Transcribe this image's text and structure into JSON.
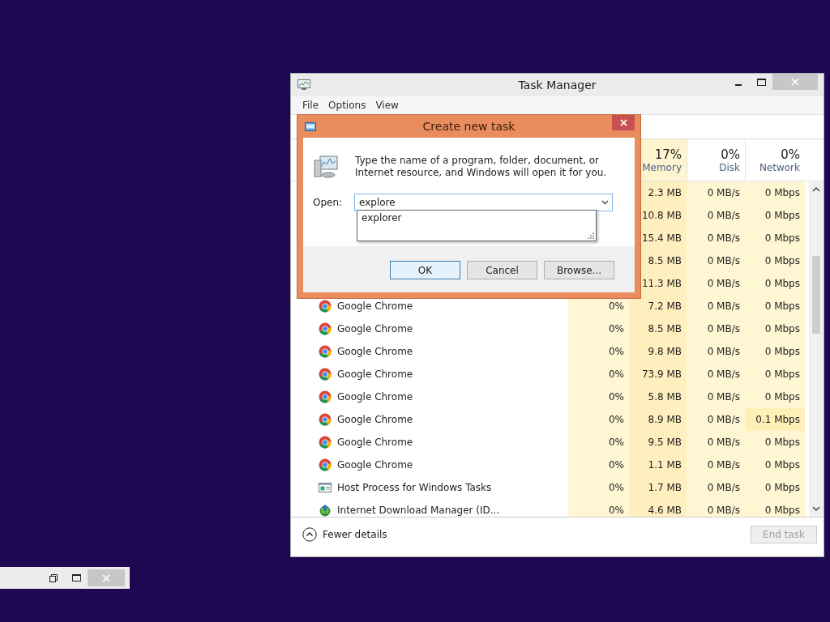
{
  "task_manager": {
    "title": "Task Manager",
    "menu": [
      "File",
      "Options",
      "View"
    ],
    "columns": [
      {
        "percent": "17%",
        "label": "Memory"
      },
      {
        "percent": "0%",
        "label": "Disk"
      },
      {
        "percent": "0%",
        "label": "Network"
      }
    ],
    "rows": [
      {
        "memory": "2.3 MB",
        "disk": "0 MB/s",
        "network": "0 Mbps"
      },
      {
        "memory": "10.8 MB",
        "disk": "0 MB/s",
        "network": "0 Mbps"
      },
      {
        "memory": "15.4 MB",
        "disk": "0 MB/s",
        "network": "0 Mbps"
      },
      {
        "memory": "8.5 MB",
        "disk": "0 MB/s",
        "network": "0 Mbps"
      },
      {
        "memory": "11.3 MB",
        "disk": "0 MB/s",
        "network": "0 Mbps"
      },
      {
        "kind": "chrome",
        "name": "Google Chrome",
        "cpu": "0%",
        "memory": "7.2 MB",
        "disk": "0 MB/s",
        "network": "0 Mbps"
      },
      {
        "kind": "chrome",
        "name": "Google Chrome",
        "cpu": "0%",
        "memory": "8.5 MB",
        "disk": "0 MB/s",
        "network": "0 Mbps"
      },
      {
        "kind": "chrome",
        "name": "Google Chrome",
        "cpu": "0%",
        "memory": "9.8 MB",
        "disk": "0 MB/s",
        "network": "0 Mbps"
      },
      {
        "kind": "chrome",
        "name": "Google Chrome",
        "cpu": "0%",
        "memory": "73.9 MB",
        "disk": "0 MB/s",
        "network": "0 Mbps"
      },
      {
        "kind": "chrome",
        "name": "Google Chrome",
        "cpu": "0%",
        "memory": "5.8 MB",
        "disk": "0 MB/s",
        "network": "0 Mbps"
      },
      {
        "kind": "chrome",
        "name": "Google Chrome",
        "cpu": "0%",
        "memory": "8.9 MB",
        "disk": "0 MB/s",
        "network": "0.1 Mbps"
      },
      {
        "kind": "chrome",
        "name": "Google Chrome",
        "cpu": "0%",
        "memory": "9.5 MB",
        "disk": "0 MB/s",
        "network": "0 Mbps"
      },
      {
        "kind": "chrome",
        "name": "Google Chrome",
        "cpu": "0%",
        "memory": "1.1 MB",
        "disk": "0 MB/s",
        "network": "0 Mbps"
      },
      {
        "kind": "host",
        "name": "Host Process for Windows Tasks",
        "cpu": "0%",
        "memory": "1.7 MB",
        "disk": "0 MB/s",
        "network": "0 Mbps"
      },
      {
        "kind": "idm",
        "name": "Internet Download Manager (ID...",
        "cpu": "0%",
        "memory": "4.6 MB",
        "disk": "0 MB/s",
        "network": "0 Mbps"
      }
    ],
    "fewer_details": "Fewer details",
    "end_task": {
      "label": "End task",
      "disabled": true
    }
  },
  "dialog": {
    "title": "Create new task",
    "message": "Type the name of a program, folder, document, or Internet resource, and Windows will open it for you.",
    "open_label": "Open:",
    "open_value": "explore",
    "suggestions": [
      "explorer"
    ],
    "buttons": [
      {
        "label": "OK",
        "selected": true
      },
      {
        "label": "Cancel",
        "selected": false
      },
      {
        "label": "Browse...",
        "selected": false
      }
    ]
  }
}
